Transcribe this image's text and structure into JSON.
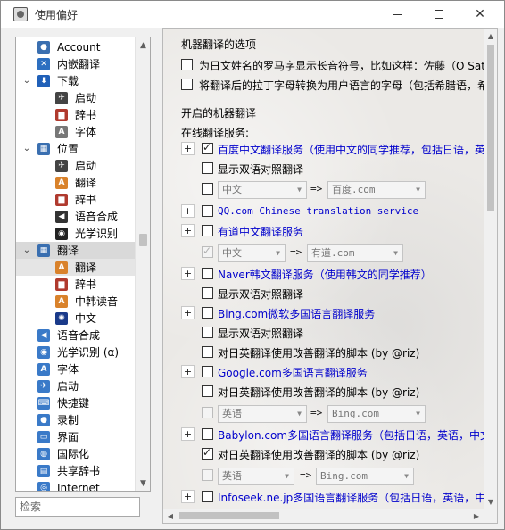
{
  "window": {
    "title": "使用偏好"
  },
  "sidebar": {
    "items": [
      {
        "label": "Account",
        "icon": "person-icon",
        "color": "#3a6fb0"
      },
      {
        "label": "内嵌翻译",
        "icon": "translate-tools-icon",
        "color": "#2d6fc0"
      },
      {
        "label": "下载",
        "icon": "download-icon",
        "color": "#2060b8",
        "expanded": true
      },
      {
        "label": "启动",
        "icon": "rocket-icon",
        "color": "#444"
      },
      {
        "label": "辞书",
        "icon": "book-icon",
        "color": "#b03a2e"
      },
      {
        "label": "字体",
        "icon": "font-icon",
        "color": "#777"
      },
      {
        "label": "位置",
        "icon": "location-icon",
        "color": "#3a6fb0",
        "expanded": true
      },
      {
        "label": "启动",
        "icon": "rocket-icon",
        "color": "#444"
      },
      {
        "label": "翻译",
        "icon": "translate-icon",
        "color": "#d9822b"
      },
      {
        "label": "辞书",
        "icon": "book-icon",
        "color": "#b03a2e"
      },
      {
        "label": "语音合成",
        "icon": "speaker-icon",
        "color": "#333"
      },
      {
        "label": "光学识别",
        "icon": "ocr-icon",
        "color": "#222"
      },
      {
        "label": "翻译",
        "icon": "translate-group-icon",
        "color": "#3a6fb0",
        "expanded": true,
        "selected": true
      },
      {
        "label": "翻译",
        "icon": "translate-icon",
        "color": "#d9822b",
        "selected": true
      },
      {
        "label": "辞书",
        "icon": "book-icon",
        "color": "#b03a2e"
      },
      {
        "label": "中韩读音",
        "icon": "translate-icon",
        "color": "#d9822b"
      },
      {
        "label": "中文",
        "icon": "star-icon",
        "color": "#1a3a8a"
      },
      {
        "label": "语音合成",
        "icon": "speaker-icon",
        "color": "#3a7ac8"
      },
      {
        "label": "光学识别 (α)",
        "icon": "ocr-icon",
        "color": "#3a7ac8"
      },
      {
        "label": "字体",
        "icon": "font-icon",
        "color": "#3a7ac8"
      },
      {
        "label": "启动",
        "icon": "rocket-icon",
        "color": "#3a7ac8"
      },
      {
        "label": "快捷键",
        "icon": "keyboard-icon",
        "color": "#3a7ac8"
      },
      {
        "label": "录制",
        "icon": "record-icon",
        "color": "#3a7ac8"
      },
      {
        "label": "界面",
        "icon": "window-icon",
        "color": "#3a7ac8"
      },
      {
        "label": "国际化",
        "icon": "globe-icon",
        "color": "#3a7ac8"
      },
      {
        "label": "共享辞书",
        "icon": "shared-dict-icon",
        "color": "#3a7ac8"
      },
      {
        "label": "Internet",
        "icon": "internet-icon",
        "color": "#3a7ac8"
      }
    ],
    "search_placeholder": "检索"
  },
  "main": {
    "machine_section_title": "机器翻译的选项",
    "opt_romaji": "为日文姓名的罗马字显示长音符号，比如这样：佐藤（O Satō）",
    "opt_latin": "将翻译后的拉丁字母转换为用户语言的字母（包括希腊语，希伯来语）",
    "enabled_title": "开启的机器翻译",
    "online_services": "在线翻译服务:",
    "arrow": "=>",
    "services": {
      "baidu": "百度中文翻译服务（使用中文的同学推荐，包括日语，英语）",
      "baidu_bilingual": "显示双语对照翻译",
      "baidu_from": "中文",
      "baidu_to": "百度.com",
      "qq": "QQ.com Chinese translation service",
      "youdao": "有道中文翻译服务",
      "youdao_from": "中文",
      "youdao_to": "有道.com",
      "naver": "Naver韩文翻译服务（使用韩文的同学推荐）",
      "naver_bilingual": "显示双语对照翻译",
      "bing": "Bing.com微软多国语言翻译服务",
      "bing_bilingual": "显示双语对照翻译",
      "bing_script": "对日英翻译使用改善翻译的脚本 (by @riz)",
      "google": "Google.com多国语言翻译服务",
      "google_script": "对日英翻译使用改善翻译的脚本 (by @riz)",
      "google_from": "英语",
      "google_to": "Bing.com",
      "babylon": "Babylon.com多国语言翻译服务（包括日语，英语，中文，韩文）",
      "babylon_script": "对日英翻译使用改善翻译的脚本 (by @riz)",
      "babylon_from": "英语",
      "babylon_to": "Bing.com",
      "infoseek": "Infoseek.ne.jp多国语言翻译服务（包括日语，英语，中文，韩文）"
    }
  }
}
